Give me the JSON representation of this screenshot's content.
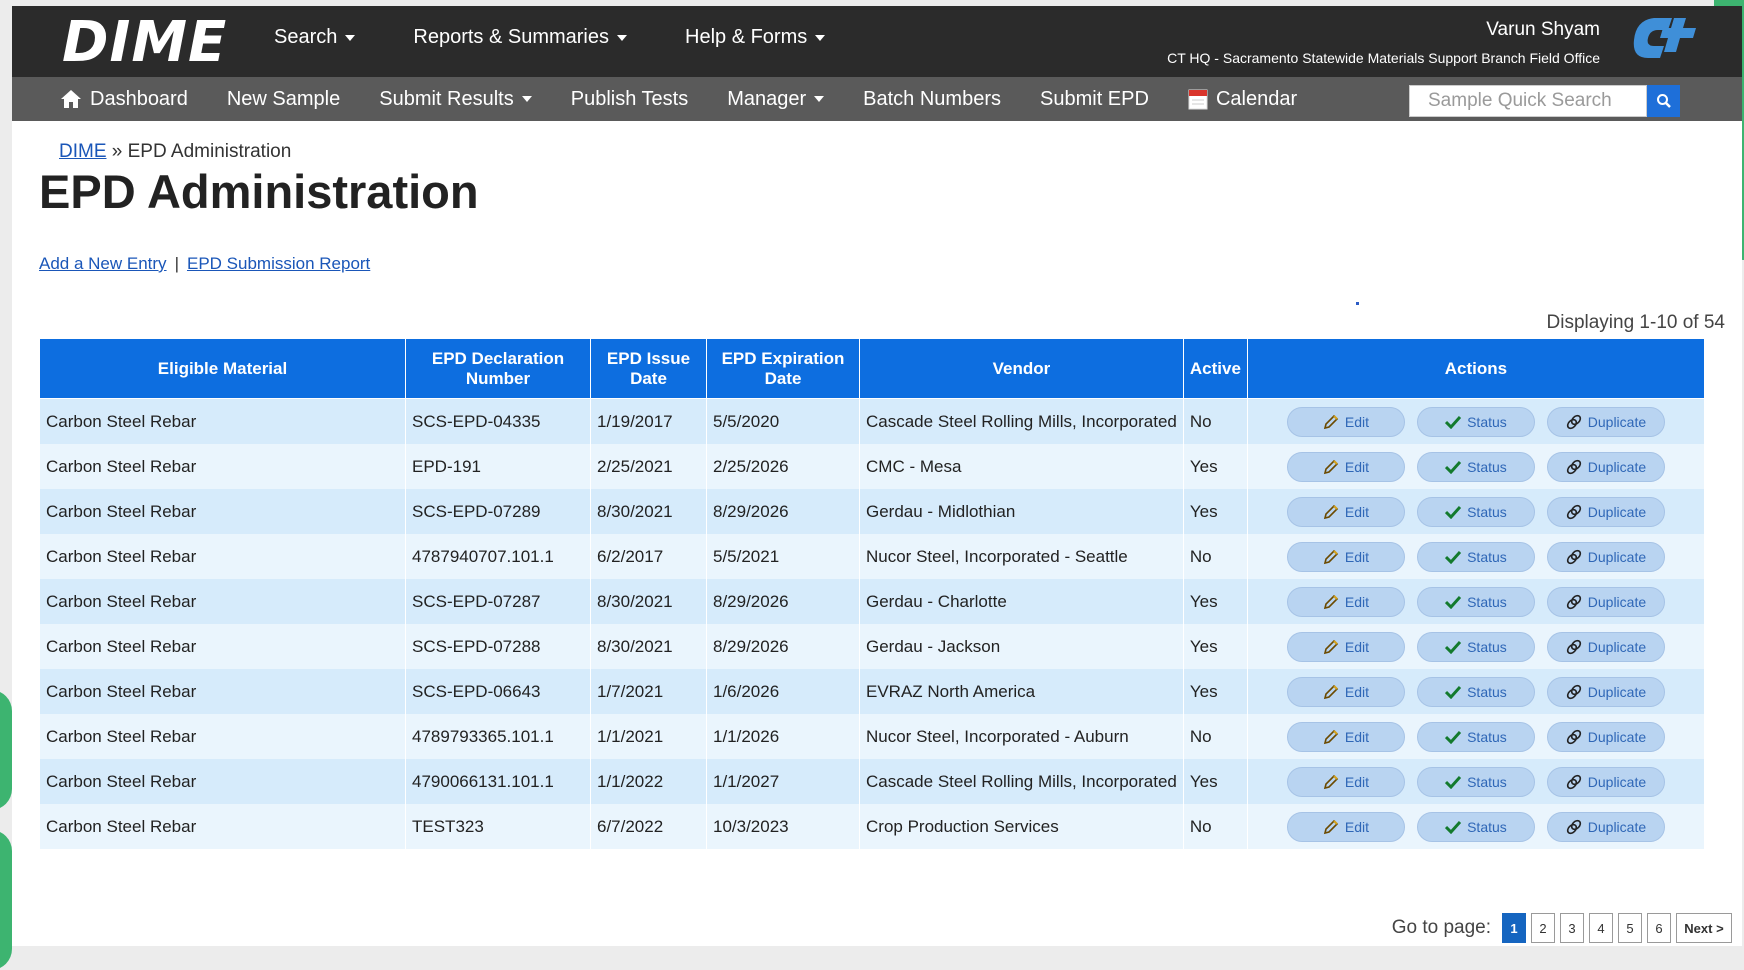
{
  "app": {
    "logo_text": "DIME"
  },
  "topnav": [
    {
      "label": "Search"
    },
    {
      "label": "Reports & Summaries"
    },
    {
      "label": "Help & Forms"
    }
  ],
  "user": {
    "name": "Varun Shyam",
    "org": "CT HQ - Sacramento Statewide Materials Support Branch Field Office"
  },
  "subnav": {
    "dashboard": "Dashboard",
    "new_sample": "New Sample",
    "submit_results": "Submit Results",
    "publish_tests": "Publish Tests",
    "manager": "Manager",
    "batch_numbers": "Batch Numbers",
    "submit_epd": "Submit EPD",
    "calendar": "Calendar"
  },
  "search": {
    "placeholder": "Sample Quick Search"
  },
  "breadcrumb": {
    "root": "DIME",
    "separator": " » ",
    "current": "EPD Administration"
  },
  "page": {
    "title": "EPD Administration"
  },
  "links": {
    "add": "Add a New Entry",
    "sep": "|",
    "report": "EPD Submission Report"
  },
  "displaying": "Displaying 1-10 of 54",
  "table": {
    "headers": {
      "material": "Eligible Material",
      "decl": "EPD Declaration Number",
      "issue": "EPD Issue Date",
      "exp": "EPD Expiration Date",
      "vendor": "Vendor",
      "active": "Active",
      "actions": "Actions"
    },
    "action_labels": {
      "edit": "Edit",
      "status": "Status",
      "duplicate": "Duplicate"
    },
    "rows": [
      {
        "material": "Carbon Steel Rebar",
        "decl": "SCS-EPD-04335",
        "issue": "1/19/2017",
        "exp": "5/5/2020",
        "vendor": "Cascade Steel Rolling Mills, Incorporated",
        "active": "No"
      },
      {
        "material": "Carbon Steel Rebar",
        "decl": "EPD-191",
        "issue": "2/25/2021",
        "exp": "2/25/2026",
        "vendor": "CMC - Mesa",
        "active": "Yes"
      },
      {
        "material": "Carbon Steel Rebar",
        "decl": "SCS-EPD-07289",
        "issue": "8/30/2021",
        "exp": "8/29/2026",
        "vendor": "Gerdau - Midlothian",
        "active": "Yes"
      },
      {
        "material": "Carbon Steel Rebar",
        "decl": "4787940707.101.1",
        "issue": "6/2/2017",
        "exp": "5/5/2021",
        "vendor": "Nucor Steel, Incorporated - Seattle",
        "active": "No"
      },
      {
        "material": "Carbon Steel Rebar",
        "decl": "SCS-EPD-07287",
        "issue": "8/30/2021",
        "exp": "8/29/2026",
        "vendor": "Gerdau - Charlotte",
        "active": "Yes"
      },
      {
        "material": "Carbon Steel Rebar",
        "decl": "SCS-EPD-07288",
        "issue": "8/30/2021",
        "exp": "8/29/2026",
        "vendor": "Gerdau - Jackson",
        "active": "Yes"
      },
      {
        "material": "Carbon Steel Rebar",
        "decl": "SCS-EPD-06643",
        "issue": "1/7/2021",
        "exp": "1/6/2026",
        "vendor": "EVRAZ North America",
        "active": "Yes"
      },
      {
        "material": "Carbon Steel Rebar",
        "decl": "4789793365.101.1",
        "issue": "1/1/2021",
        "exp": "1/1/2026",
        "vendor": "Nucor Steel, Incorporated - Auburn",
        "active": "No"
      },
      {
        "material": "Carbon Steel Rebar",
        "decl": "4790066131.101.1",
        "issue": "1/1/2022",
        "exp": "1/1/2027",
        "vendor": "Cascade Steel Rolling Mills, Incorporated",
        "active": "Yes"
      },
      {
        "material": "Carbon Steel Rebar",
        "decl": "TEST323",
        "issue": "6/7/2022",
        "exp": "10/3/2023",
        "vendor": "Crop Production Services",
        "active": "No"
      }
    ]
  },
  "pager": {
    "label": "Go to page:",
    "pages": [
      "1",
      "2",
      "3",
      "4",
      "5",
      "6"
    ],
    "current": "1",
    "next": "Next >"
  },
  "colors": {
    "header_bg": "#2b2b2b",
    "subnav_bg": "#5a5a5a",
    "table_header": "#0d6ee0",
    "accent": "#1e6fd9"
  }
}
